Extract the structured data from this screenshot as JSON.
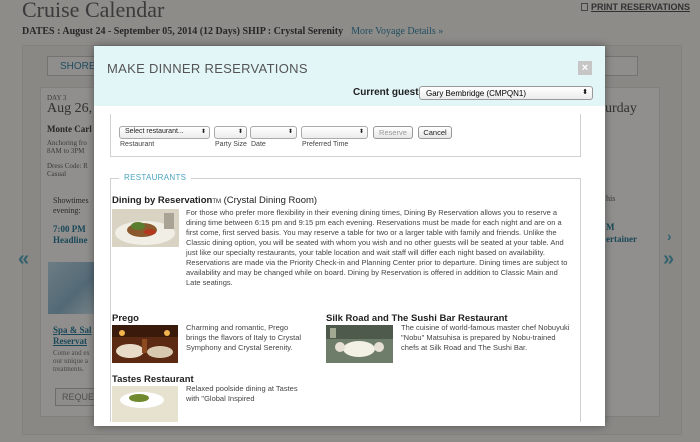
{
  "background": {
    "title": "Cruise Calendar",
    "print_link": "PRINT RESERVATIONS",
    "voyage_line": "DATES : August 24 - September 05, 2014 (12 Days)   SHIP : Crystal Serenity",
    "more_details": "More Voyage Details »",
    "tab_label": "SHORE",
    "day_label": "DAY 3",
    "day_date": "Aug 26, '",
    "port": "Monte Carl",
    "anchoring": "Anchoring fro",
    "anchoring2": "8AM to 3PM",
    "dress_code": "Dress Code: R",
    "casual": "Casual",
    "showtimes": "Showtimes",
    "evening": "evening:",
    "time": "7:00 PM",
    "headline": "Headline",
    "spa": "Spa & Sal",
    "reserve": "Reservat",
    "come": "Come and ex",
    "our": "our unique a",
    "treat": "treatments.",
    "request_btn": "REQUEST",
    "right_day": "urday",
    "right_his": "his",
    "right_time": "M",
    "right_ent": "ertainer"
  },
  "modal": {
    "title": "MAKE DINNER RESERVATIONS",
    "close_label": "×",
    "current_guest_label": "Current guest:",
    "current_guest_value": "Gary Bembridge (CMPQN1)",
    "form": {
      "restaurant_select": "Select restaurant...",
      "party_size_select": "",
      "date_select": "",
      "time_select": "",
      "reserve_btn": "Reserve",
      "cancel_btn": "Cancel",
      "restaurant_label": "Restaurant",
      "party_size_label": "Party Size",
      "date_label": "Date",
      "time_label": "Preferred Time"
    },
    "restaurants_legend": "RESTAURANTS",
    "restaurants": [
      {
        "name": "Dining by Reservation",
        "tm": "TM",
        "subtitle": " (Crystal Dining Room)",
        "description": "For those who prefer more flexibility in their evening dining times, Dining By Reservation allows you to reserve a dining time between 6:15 pm and 9:15 pm each evening. Reservations must be made for each night and are on a first come, first served basis. You may reserve a table for two or a larger table with family and friends. Unlike the Classic dining option, you will be seated with whom you wish and no other guests will be seated at your table. And just like our specialty restaurants, your table location and wait staff will differ each night based on availability. Reservations are made via the Priority Check-in and Planning Center prior to departure. Dining times are subject to availability and may be changed while on board. Dining by Reservation is offered in addition to Classic Main and Late seatings."
      },
      {
        "name": "Prego",
        "description": "Charming and romantic, Prego brings the flavors of Italy to Crystal Symphony and Crystal Serenity."
      },
      {
        "name": "Silk Road and The Sushi Bar Restaurant",
        "description": "The cuisine of world-famous master chef Nobuyuki \"Nobu\" Matsuhisa is prepared by Nobu-trained chefs at Silk Road and The Sushi Bar."
      },
      {
        "name": "Tastes Restaurant",
        "description": "Relaxed poolside dining at Tastes with \"Global Inspired"
      }
    ]
  }
}
